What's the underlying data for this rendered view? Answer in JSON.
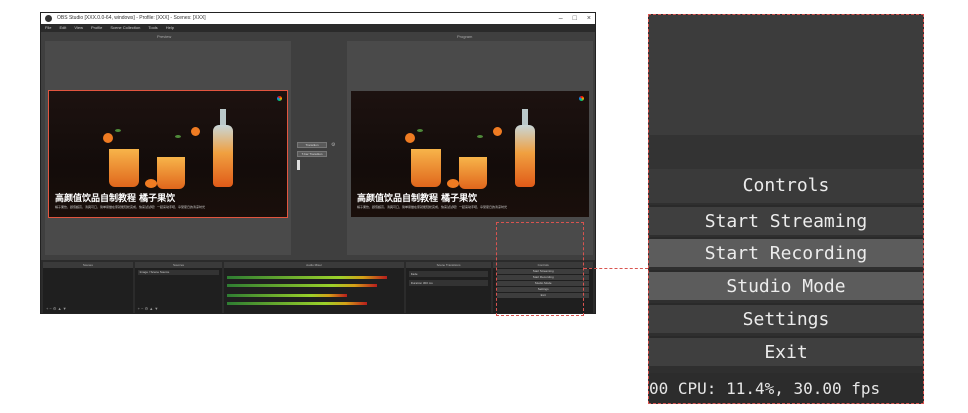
{
  "window": {
    "title": "OBS Studio [XXX.0.0-64, windows] - Profile: [XXX] - Scenes: [XXX]",
    "controls": [
      "–",
      "□",
      "×"
    ],
    "menu": [
      "File",
      "Edit",
      "View",
      "Profile",
      "Scene Collection",
      "Tools",
      "Help"
    ]
  },
  "canvas": {
    "preview_label": "Preview",
    "program_label": "Program",
    "scene_title": "高颜值饮品自制教程 橘子果饮",
    "scene_caption": "橘子果饮，颜值超高，清爽可口，简单易做在家就能轻松完成，快来试试吧！一起来动手吧，享受夏日的清凉时光",
    "transition_label": "Transition",
    "quick_transition": "T-bar Transition"
  },
  "docks": {
    "scenes_title": "Scenes",
    "sources_title": "Sources",
    "mixer_title": "Audio Mixer",
    "transitions_title": "Scene Transitions",
    "controls_title": "Controls",
    "source_item": "Image / Scene Source",
    "transition_item": "Fade",
    "duration_label": "Duration",
    "duration_value": "300 ms",
    "footer_icons": "+  −  ⚙  ▲  ▼",
    "mini_buttons": [
      "Start Streaming",
      "Start Recording",
      "Studio Mode",
      "Settings",
      "Exit"
    ]
  },
  "controls_panel": {
    "title": "Controls",
    "buttons": {
      "start_streaming": "Start Streaming",
      "start_recording": "Start Recording",
      "studio_mode": "Studio Mode",
      "settings": "Settings",
      "exit": "Exit"
    },
    "status": "00   CPU: 11.4%, 30.00 fps"
  },
  "colors": {
    "highlight": "#d9534f",
    "panel_bg": "#2f2f2f",
    "button_bg": "#3f3f3f",
    "button_active": "#5c5c5c"
  }
}
